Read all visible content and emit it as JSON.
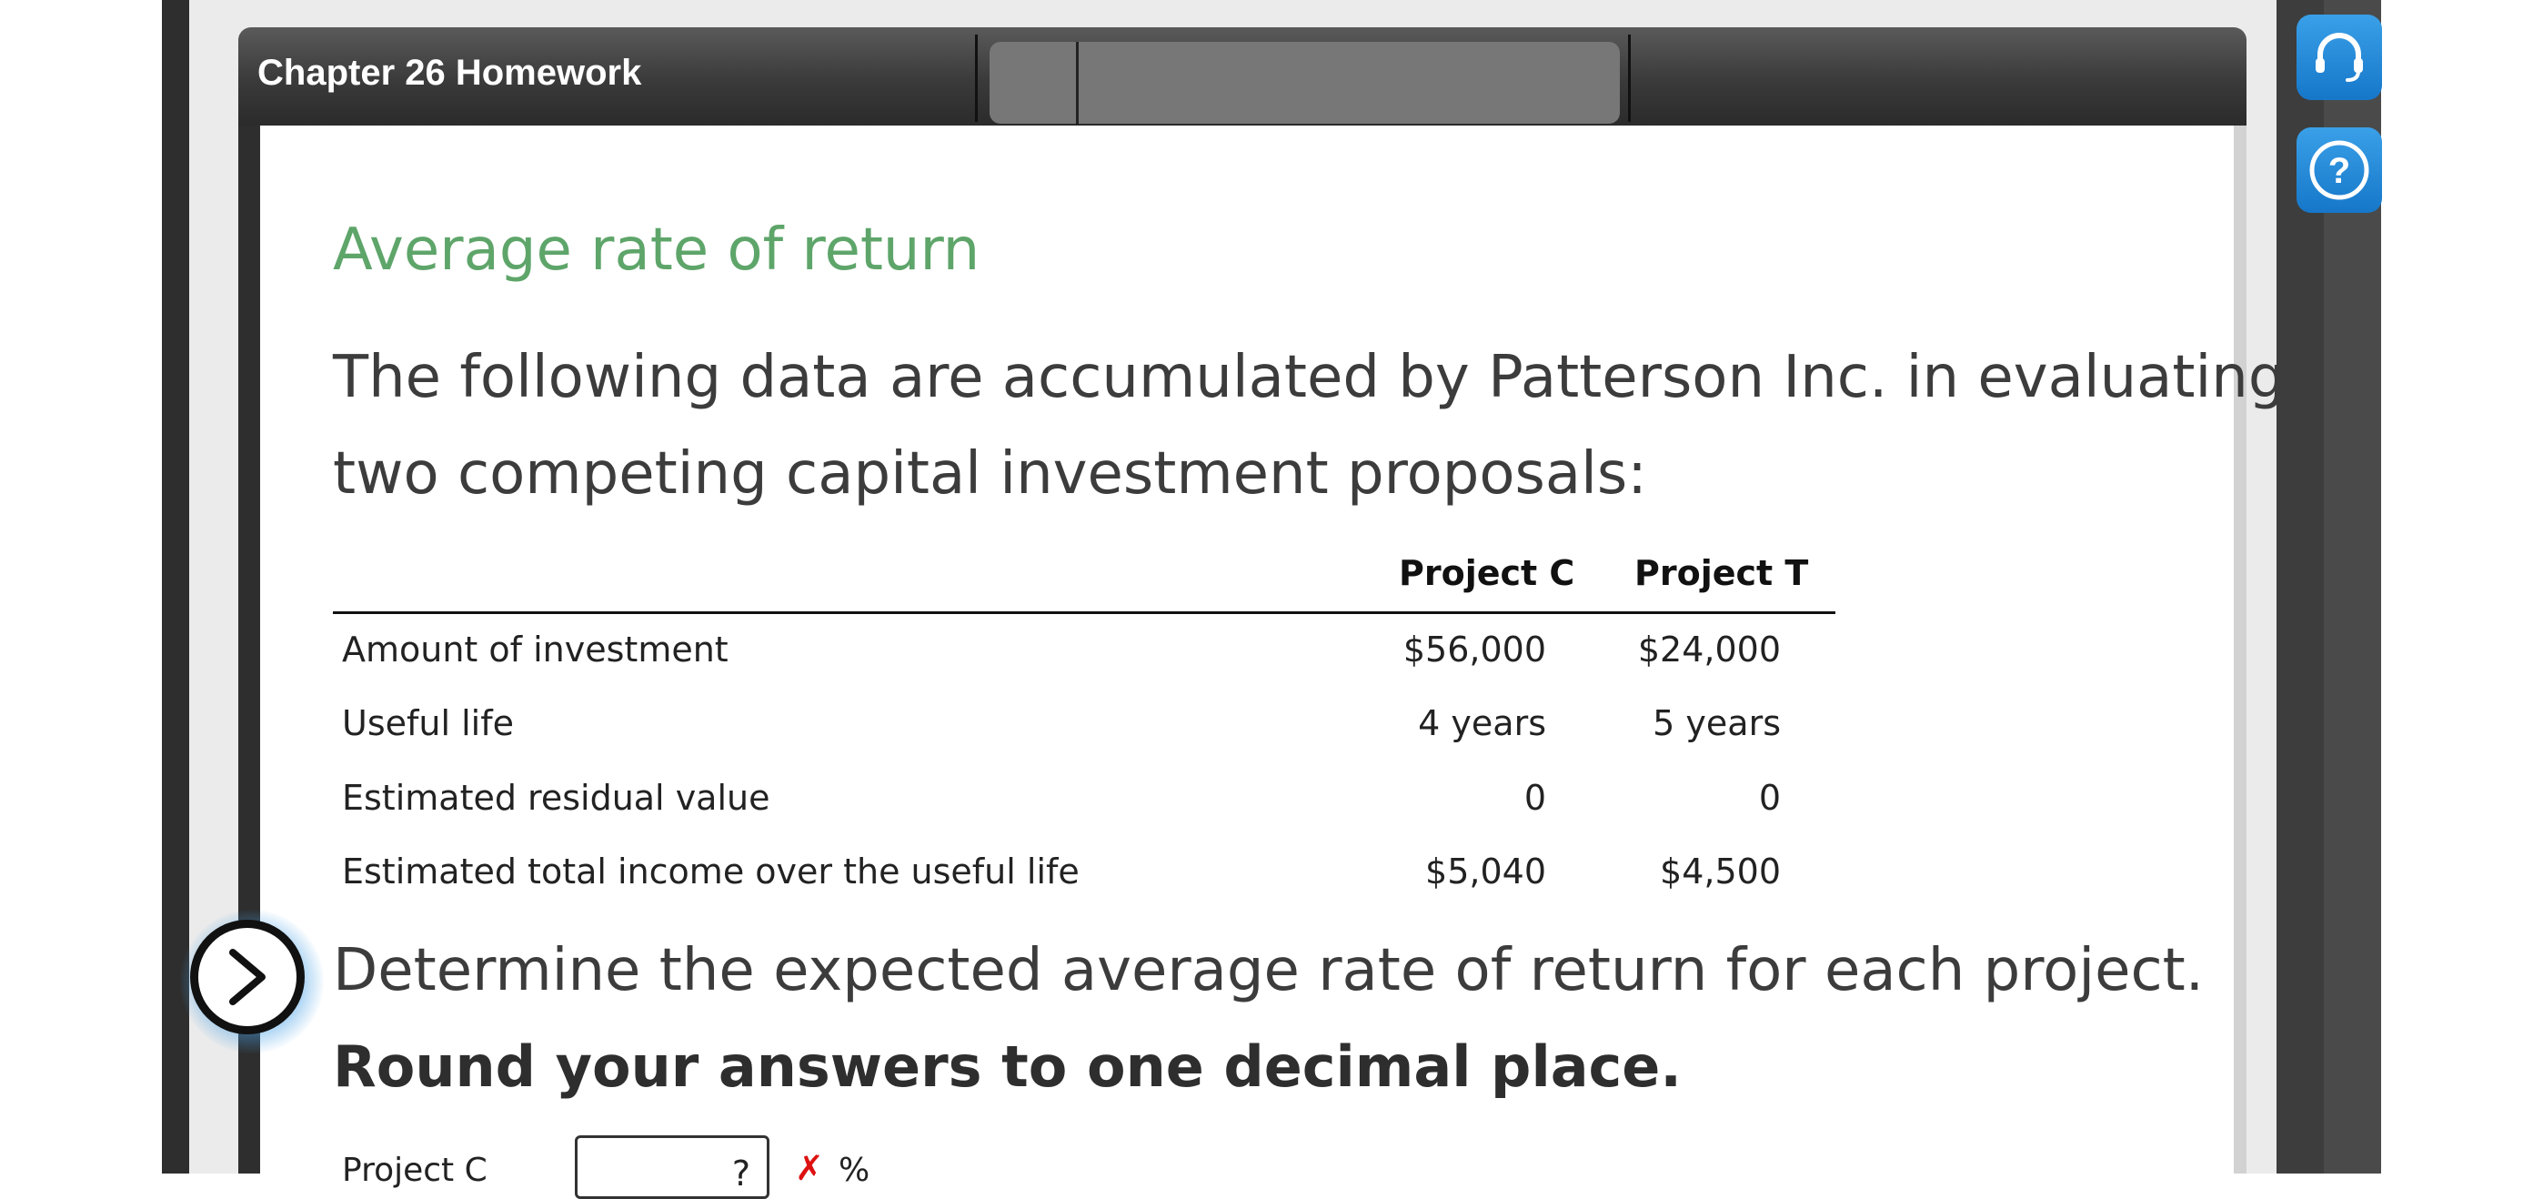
{
  "header": {
    "title": "Chapter 26 Homework"
  },
  "section": {
    "title": "Average rate of return",
    "intro_line_1": "The following data are accumulated by Patterson Inc. in evaluating",
    "intro_line_2": "two competing capital investment proposals:"
  },
  "table": {
    "columns": [
      "Project C",
      "Project T"
    ],
    "rows": [
      {
        "label": "Amount of investment",
        "c": "$56,000",
        "t": "$24,000"
      },
      {
        "label": "Useful life",
        "c": "4 years",
        "t": "5 years"
      },
      {
        "label": "Estimated residual value",
        "c": "0",
        "t": "0"
      },
      {
        "label": "Estimated total income over the useful life",
        "c": "$5,040",
        "t": "$4,500"
      }
    ]
  },
  "question": {
    "instruction": "Determine the expected average rate of return for each project.",
    "round_note": "Round your answers to one decimal place.",
    "answer_label": "Project C",
    "answer_value": "?",
    "answer_status": "✗",
    "unit": "%"
  },
  "icons": {
    "step_icon": ">",
    "support_icon": "headset-icon",
    "help_icon": "?"
  },
  "colors": {
    "title_green": "#5ea56a",
    "accent_blue": "#1677c9",
    "error_red": "#dd1111"
  }
}
